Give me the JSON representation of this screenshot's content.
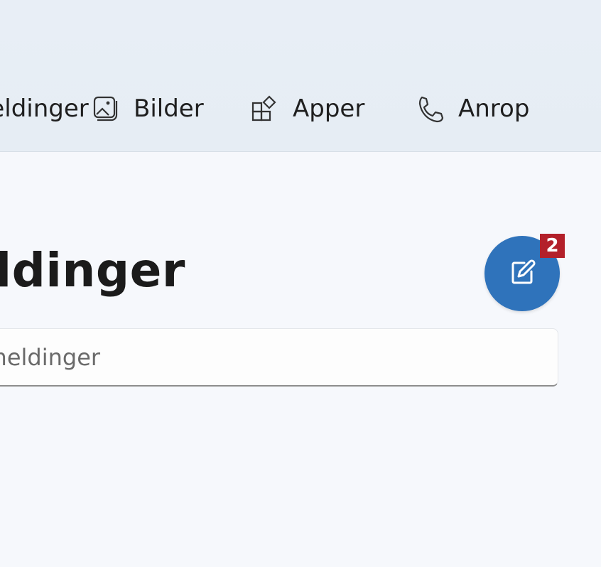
{
  "nav": {
    "tabs": [
      {
        "label": "Meldinger",
        "icon": "message-icon"
      },
      {
        "label": "Bilder",
        "icon": "image-icon"
      },
      {
        "label": "Apper",
        "icon": "apps-icon"
      },
      {
        "label": "Anrop",
        "icon": "phone-icon"
      }
    ]
  },
  "main": {
    "title": "Meldinger",
    "compose": {
      "icon": "compose-icon",
      "badge": "2",
      "accent": "#2f73bb",
      "badge_color": "#b3202a"
    },
    "search": {
      "placeholder": "Søk i meldinger"
    }
  }
}
